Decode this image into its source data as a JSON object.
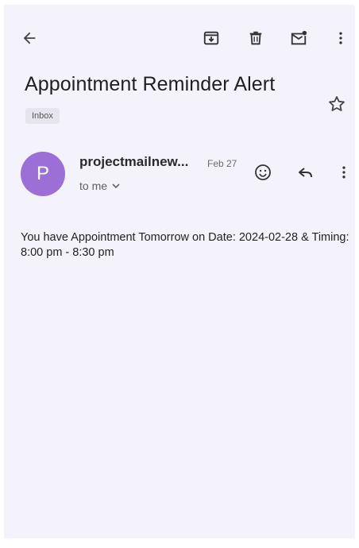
{
  "email": {
    "subject": "Appointment Reminder Alert",
    "label": "Inbox",
    "sender_initial": "P",
    "sender": "projectmailnew...",
    "date": "Feb 27",
    "recipient": "to me",
    "body": "You have Appointment Tomorrow on Date: 2024-02-28 & Timing: 8:00 pm - 8:30 pm"
  },
  "colors": {
    "avatar": "#9c6fd6",
    "background": "#f4f3fb"
  },
  "icons": [
    "back-arrow-icon",
    "archive-icon",
    "delete-icon",
    "mark-unread-icon",
    "more-vert-icon",
    "star-icon",
    "emoji-icon",
    "reply-icon",
    "more-vert-icon"
  ]
}
